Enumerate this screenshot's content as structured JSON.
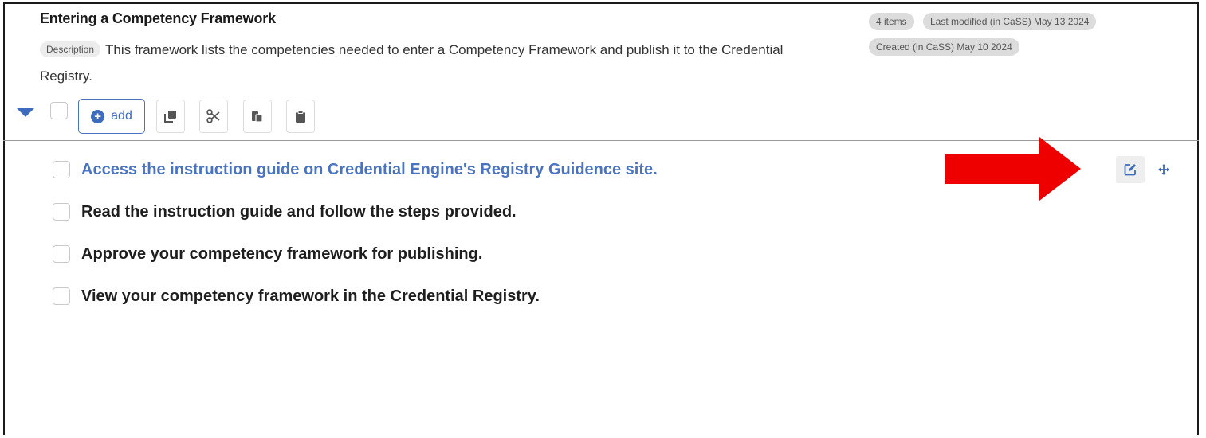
{
  "framework": {
    "title": "Entering a Competency Framework",
    "description_label": "Description",
    "description": "This framework lists the competencies needed to enter a Competency Framework and publish it to the Credential Registry.",
    "item_count": "4 items",
    "last_modified": "Last modified (in CaSS) May 13 2024",
    "created": "Created (in CaSS) May 10 2024"
  },
  "toolbar": {
    "add_label": "add",
    "tools": [
      "copy-icon",
      "scissors-icon",
      "paste-icon",
      "clipboard-icon"
    ]
  },
  "items": [
    {
      "text": "Access the instruction guide on Credential Engine's Registry Guidence site.",
      "highlighted": true
    },
    {
      "text": "Read the instruction guide and follow the steps provided.",
      "highlighted": false
    },
    {
      "text": "Approve your competency framework for publishing.",
      "highlighted": false
    },
    {
      "text": "View your competency framework in the Credential Registry.",
      "highlighted": false
    }
  ],
  "colors": {
    "accent": "#3d6bbd",
    "annotation_arrow": "#ee0000",
    "chip_bg": "#dcdcdc"
  },
  "annotation": {
    "icon": "red-arrow-icon"
  }
}
